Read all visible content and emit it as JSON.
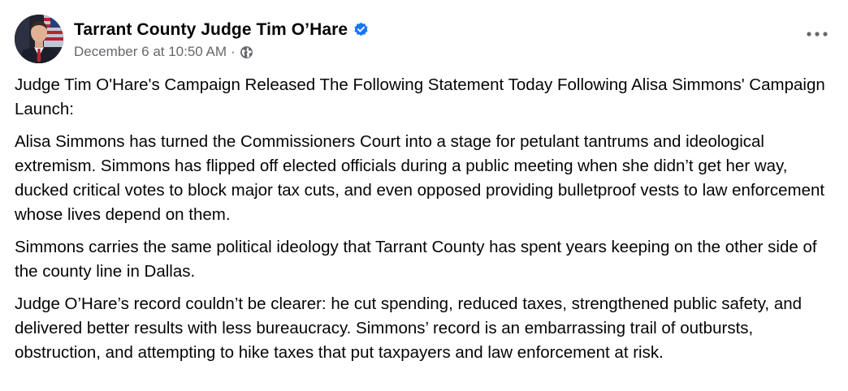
{
  "post": {
    "author": "Tarrant County Judge Tim O’Hare",
    "verified_icon": "verified-badge-icon",
    "timestamp": "December 6 at 10:50 AM",
    "separator": "·",
    "audience_icon": "globe-icon",
    "more_icon": "more-options-icon",
    "paragraphs": [
      "Judge Tim O'Hare's Campaign Released The Following Statement Today Following Alisa Simmons' Campaign Launch:",
      "Alisa Simmons has turned the Commissioners Court into a stage for petulant tantrums and ideological extremism. Simmons has flipped off elected officials during a public meeting when she didn’t get her way, ducked critical votes to block major tax cuts, and even opposed providing bulletproof vests to law enforcement whose lives depend on them.",
      "Simmons carries the same political ideology that Tarrant County has spent years keeping on the other side of the county line in Dallas.",
      "Judge O’Hare’s record couldn’t be clearer: he cut spending, reduced taxes, strengthened public safety, and delivered better results with less bureaucracy. Simmons’ record is an embarrassing trail of outbursts, obstruction, and attempting to hike taxes that put taxpayers and law enforcement at risk."
    ]
  },
  "colors": {
    "text": "#050505",
    "secondary_text": "#65676b",
    "verified_blue": "#1877f2",
    "background": "#ffffff"
  }
}
